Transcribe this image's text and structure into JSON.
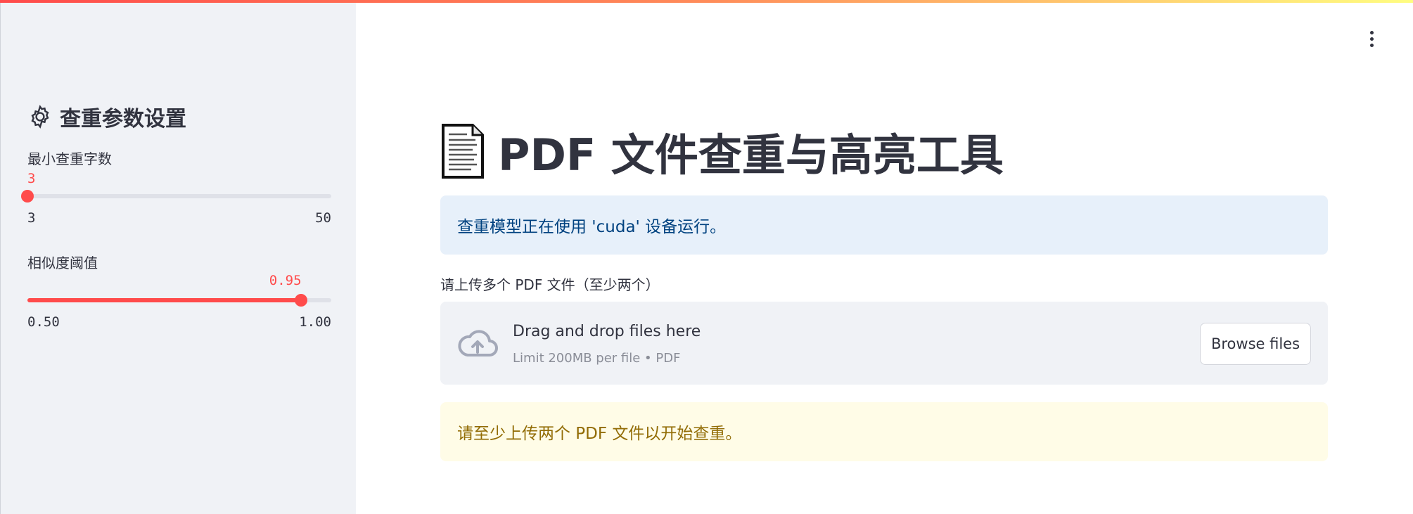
{
  "sidebar": {
    "icon": "gear-icon",
    "title": "查重参数设置",
    "min_chars": {
      "label": "最小查重字数",
      "value": 3,
      "value_text": "3",
      "min": 3,
      "max": 50,
      "min_text": "3",
      "max_text": "50"
    },
    "similarity": {
      "label": "相似度阈值",
      "value": 0.95,
      "value_text": "0.95",
      "min": 0.5,
      "max": 1.0,
      "min_text": "0.50",
      "max_text": "1.00"
    }
  },
  "main": {
    "title_icon": "document-icon",
    "title": "PDF 文件查重与高亮工具",
    "info_message": "查重模型正在使用 'cuda' 设备运行。",
    "uploader": {
      "label": "请上传多个 PDF 文件（至少两个）",
      "icon": "cloud-upload-icon",
      "drop_text": "Drag and drop files here",
      "limit_text": "Limit 200MB per file • PDF",
      "browse_label": "Browse files"
    },
    "warning_message": "请至少上传两个 PDF 文件以开始查重。"
  },
  "toolbar": {
    "menu_icon": "more-vertical-icon"
  },
  "colors": {
    "accent": "#ff4b4b",
    "sidebar_bg": "#f0f2f6",
    "info_bg": "#e7f0fa",
    "warning_bg": "#fffce7"
  }
}
